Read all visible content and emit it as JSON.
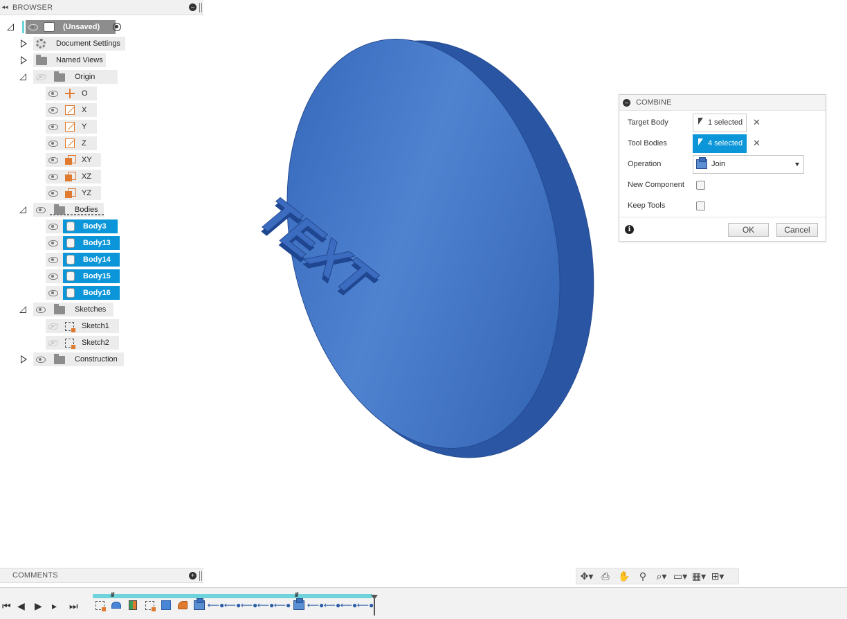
{
  "browser": {
    "title": "BROWSER",
    "root_label": "(Unsaved)",
    "items": [
      {
        "label": "Document Settings"
      },
      {
        "label": "Named Views"
      },
      {
        "label": "Origin"
      },
      {
        "label": "O"
      },
      {
        "label": "X"
      },
      {
        "label": "Y"
      },
      {
        "label": "Z"
      },
      {
        "label": "XY"
      },
      {
        "label": "XZ"
      },
      {
        "label": "YZ"
      },
      {
        "label": "Bodies"
      },
      {
        "label": "Body3"
      },
      {
        "label": "Body13"
      },
      {
        "label": "Body14"
      },
      {
        "label": "Body15"
      },
      {
        "label": "Body16"
      },
      {
        "label": "Sketches"
      },
      {
        "label": "Sketch1"
      },
      {
        "label": "Sketch2"
      },
      {
        "label": "Construction"
      }
    ]
  },
  "comments": {
    "title": "COMMENTS"
  },
  "model": {
    "text": "TEXT",
    "color": "#3a6fc4"
  },
  "combine": {
    "title": "COMBINE",
    "target_body_label": "Target Body",
    "target_body_value": "1 selected",
    "tool_bodies_label": "Tool Bodies",
    "tool_bodies_value": "4 selected",
    "operation_label": "Operation",
    "operation_value": "Join",
    "new_component_label": "New Component",
    "keep_tools_label": "Keep Tools",
    "ok_label": "OK",
    "cancel_label": "Cancel"
  },
  "colors": {
    "selection": "#0a96d8",
    "accent_orange": "#e07a2e",
    "timeline_track": "#6fd3dc"
  }
}
